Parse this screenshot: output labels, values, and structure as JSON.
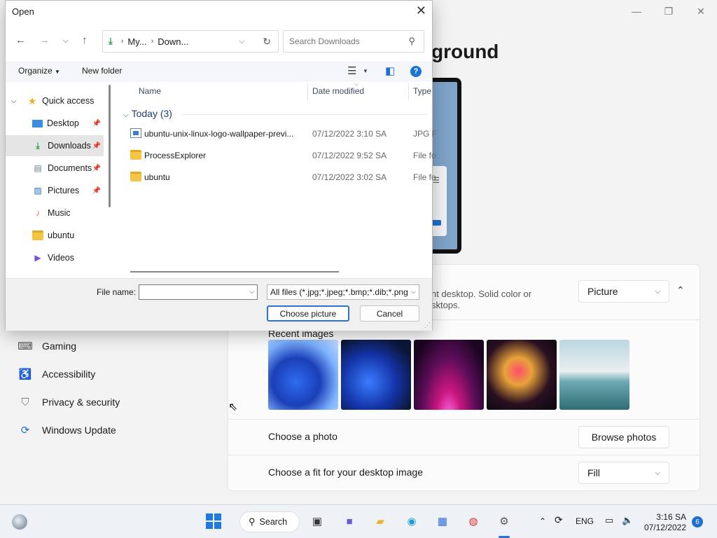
{
  "dialog": {
    "title": "Open",
    "address": {
      "segments": [
        "My...",
        "Down..."
      ]
    },
    "search_placeholder": "Search Downloads",
    "toolbar": {
      "organize": "Organize",
      "new_folder": "New folder",
      "help": "?"
    },
    "sidebar": {
      "quick_access": "Quick access",
      "items": [
        {
          "label": "Desktop",
          "pinned": true
        },
        {
          "label": "Downloads",
          "pinned": true,
          "selected": true
        },
        {
          "label": "Documents",
          "pinned": true
        },
        {
          "label": "Pictures",
          "pinned": true
        },
        {
          "label": "Music",
          "pinned": false
        },
        {
          "label": "ubuntu",
          "pinned": false
        },
        {
          "label": "Videos",
          "pinned": false
        }
      ]
    },
    "columns": {
      "name": "Name",
      "date": "Date modified",
      "type": "Type"
    },
    "group": "Today (3)",
    "files": [
      {
        "name": "ubuntu-unix-linux-logo-wallpaper-previ...",
        "date": "07/12/2022 3:10 SA",
        "type": "JPG F"
      },
      {
        "name": "ProcessExplorer",
        "date": "07/12/2022 9:52 SA",
        "type": "File fo"
      },
      {
        "name": "ubuntu",
        "date": "07/12/2022 3:02 SA",
        "type": "File fo"
      }
    ],
    "file_name_label": "File name:",
    "file_name_value": "",
    "file_type": "All files (*.jpg;*.jpeg;*.bmp;*.dib;*.png",
    "choose_button": "Choose picture",
    "cancel_button": "Cancel"
  },
  "settings": {
    "title": "ground",
    "background_desc_line1": "nt desktop. Solid color or",
    "background_desc_line2": "sktops.",
    "background_type": "Picture",
    "recent_images_label": "Recent images",
    "choose_photo_label": "Choose a photo",
    "browse_button": "Browse photos",
    "fit_label": "Choose a fit for your desktop image",
    "fit_value": "Fill",
    "nav": [
      {
        "label": "Gaming",
        "icon": "gamepad-icon"
      },
      {
        "label": "Accessibility",
        "icon": "accessibility-icon"
      },
      {
        "label": "Privacy & security",
        "icon": "shield-icon"
      },
      {
        "label": "Windows Update",
        "icon": "update-icon"
      }
    ]
  },
  "taskbar": {
    "search_label": "Search",
    "lang": "ENG",
    "time": "3:16 SA",
    "date": "07/12/2022",
    "notifications": "6"
  },
  "colors": {
    "accent": "#2f6fd6",
    "selected_bg": "#e5e5e5",
    "folder": "#f4c443"
  }
}
